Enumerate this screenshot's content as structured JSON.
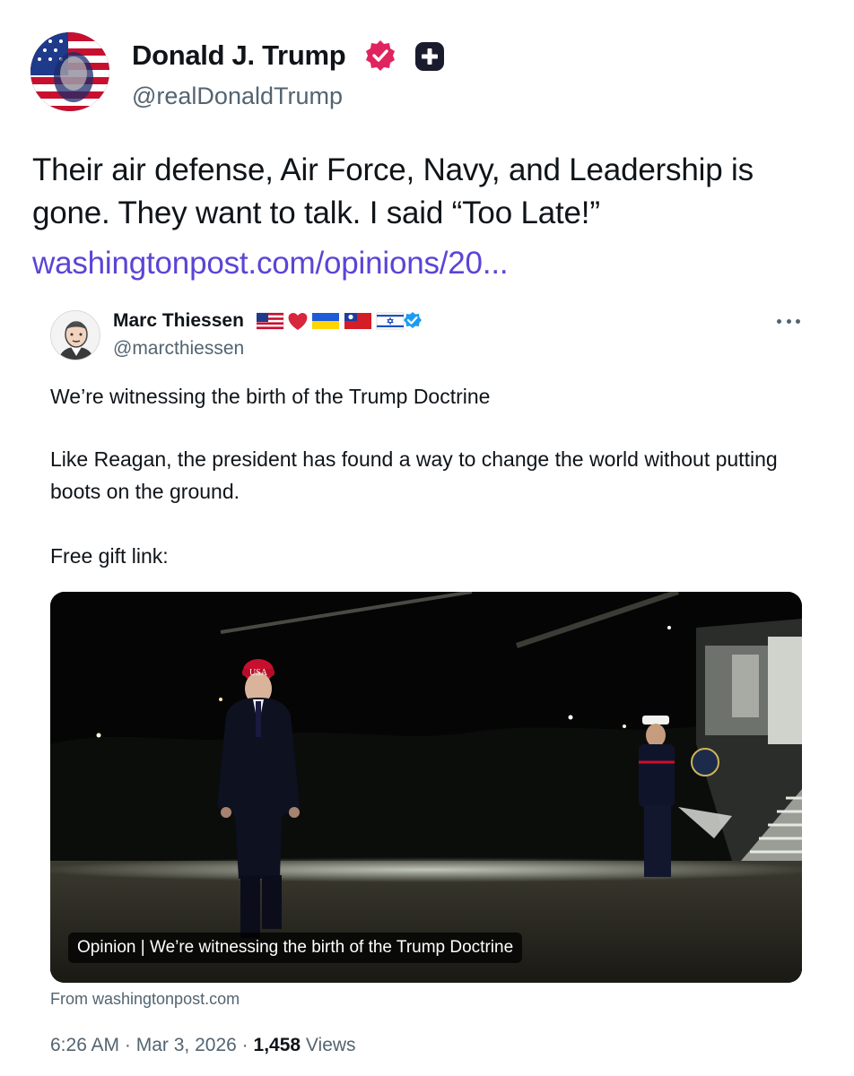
{
  "author": {
    "display_name": "Donald J. Trump",
    "handle": "@realDonaldTrump",
    "verified_badge_icon": "verified-badge-icon",
    "verified_color": "#e0245e",
    "extra_badge_icon": "plus-badge-icon"
  },
  "post": {
    "text": "Their air defense, Air Force, Navy, and Leadership is gone. They want to talk. I said “Too Late!”",
    "link": "washingtonpost.com/opinions/20...",
    "link_color": "#5b44d6"
  },
  "quote": {
    "display_name": "Marc Thiessen",
    "handle": "@marcthiessen",
    "name_emoji_icons": [
      "us-flag-icon",
      "red-heart-icon",
      "ukraine-flag-icon",
      "taiwan-flag-icon",
      "israel-flag-icon",
      "verified-blue-icon"
    ],
    "more_icon": "more-options-icon",
    "paragraph_1": "We’re witnessing the birth of the Trump Doctrine",
    "paragraph_2": "Like Reagan, the president has found a way to change the world without putting boots on the ground.",
    "paragraph_3": "Free gift link:",
    "card": {
      "image_cap_text": "USA",
      "caption": "Opinion | We’re witnessing the birth of the Trump Doctrine",
      "source": "From washingtonpost.com"
    }
  },
  "meta": {
    "time": "6:26 AM",
    "separator": "·",
    "date": "Mar 3, 2026",
    "views_count": "1,458",
    "views_label": "Views"
  }
}
